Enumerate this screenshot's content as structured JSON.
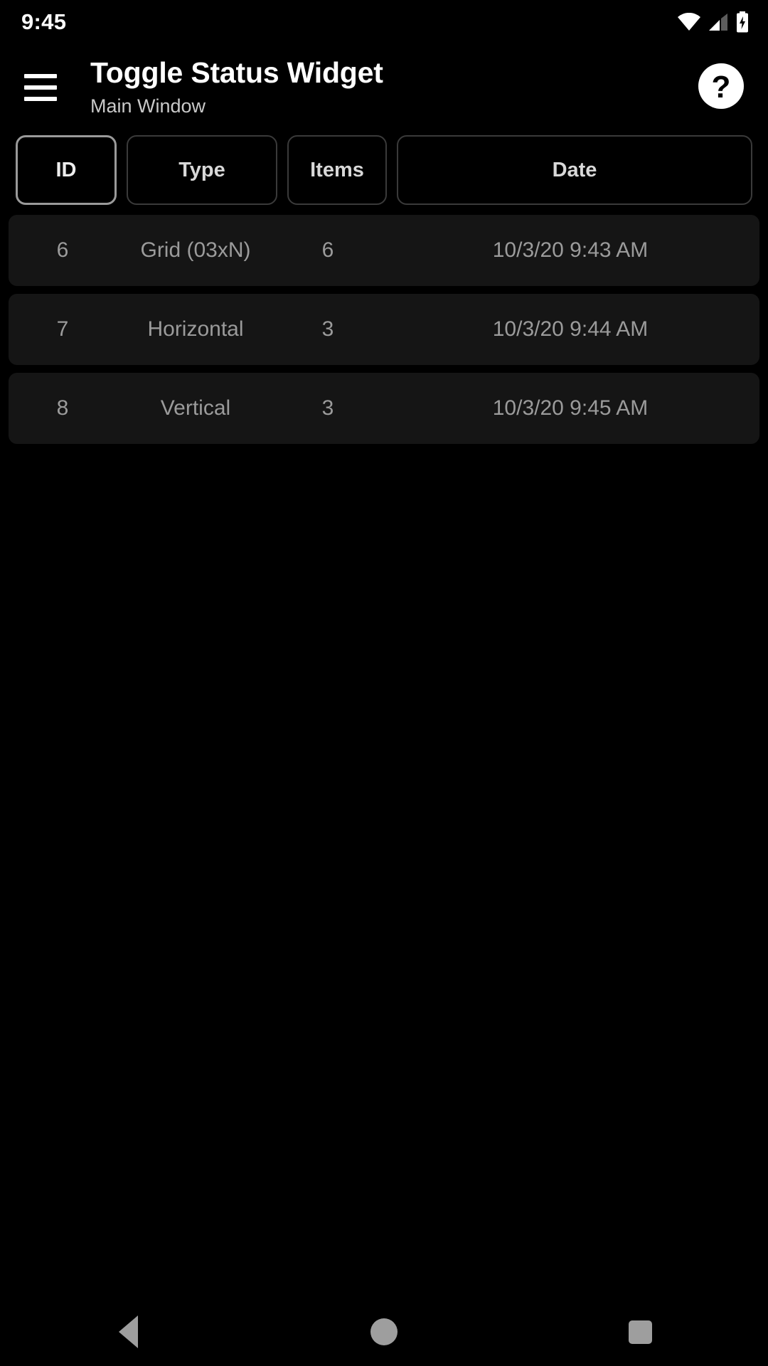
{
  "status_bar": {
    "clock": "9:45",
    "icons": [
      {
        "name": "wifi-icon",
        "label": "wifi"
      },
      {
        "name": "cellular-signal-icon",
        "label": "cellular"
      },
      {
        "name": "battery-charging-icon",
        "label": "battery charging"
      }
    ]
  },
  "app_bar": {
    "menu_icon": "hamburger-menu-icon",
    "title": "Toggle Status Widget",
    "subtitle": "Main Window",
    "help_icon": "help-question-icon"
  },
  "columns": [
    {
      "key": "id",
      "label": "ID",
      "selected": true
    },
    {
      "key": "type",
      "label": "Type",
      "selected": false
    },
    {
      "key": "items",
      "label": "Items",
      "selected": false
    },
    {
      "key": "date",
      "label": "Date",
      "selected": false
    }
  ],
  "rows": [
    {
      "id": "6",
      "type": "Grid (03xN)",
      "items": "6",
      "date": "10/3/20 9:43 AM"
    },
    {
      "id": "7",
      "type": "Horizontal",
      "items": "3",
      "date": "10/3/20 9:44 AM"
    },
    {
      "id": "8",
      "type": "Vertical",
      "items": "3",
      "date": "10/3/20 9:45 AM"
    }
  ],
  "nav_bar": {
    "back": "back-nav-icon",
    "home": "home-nav-icon",
    "recents": "recents-nav-icon"
  },
  "colors": {
    "background": "#000000",
    "row_background": "#151515",
    "row_text": "#9b9b9b",
    "header_text": "#d8d8d8",
    "header_border": "#3a3a3a",
    "header_border_selected": "#9a9a9a",
    "title_text": "#ffffff",
    "subtitle_text": "#c9c9c9",
    "nav_icon": "#9e9e9e"
  }
}
